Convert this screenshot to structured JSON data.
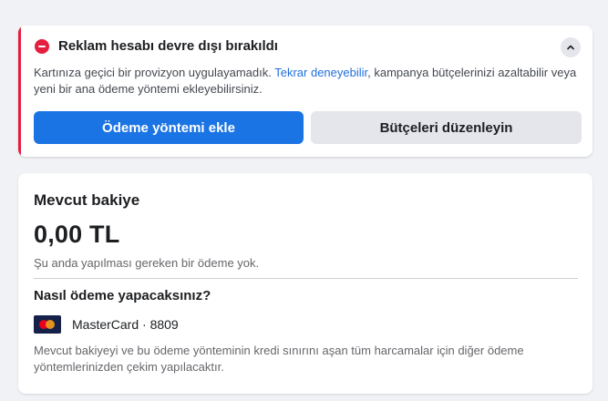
{
  "alert": {
    "title": "Reklam hesabı devre dışı bırakıldı",
    "message_before": "Kartınıza geçici bir provizyon uygulayamadık. ",
    "message_link": "Tekrar deneyebilir",
    "message_after": ", kampanya bütçelerinizi azaltabilir veya yeni bir ana ödeme yöntemi ekleyebilirsiniz.",
    "primary_button": "Ödeme yöntemi ekle",
    "secondary_button": "Bütçeleri düzenleyin",
    "icon": "error-minus-icon",
    "accent_color": "#e41e3f"
  },
  "balance": {
    "title": "Mevcut bakiye",
    "amount": "0,00 TL",
    "note": "Şu anda yapılması gereken bir ödeme yok.",
    "question": "Nasıl ödeme yapacaksınız?",
    "card_label": "MasterCard · 8809",
    "card_icon": "mastercard-icon",
    "footnote": "Mevcut bakiyeyi ve bu ödeme yönteminin kredi sınırını aşan tüm harcamalar için diğer ödeme yöntemlerinizden çekim yapılacaktır."
  },
  "colors": {
    "primary": "#1b74e4",
    "link": "#216fdb",
    "background": "#f0f2f5"
  }
}
